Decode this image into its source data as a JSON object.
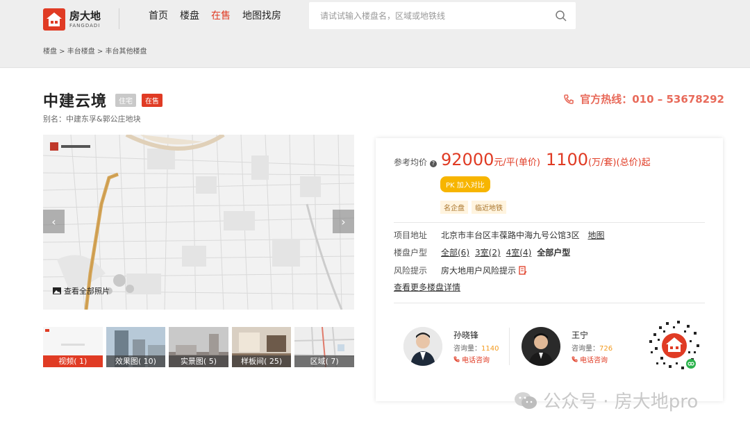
{
  "header": {
    "logo_cn": "房大地",
    "logo_en": "FANGDADI",
    "nav": [
      {
        "label": "首页",
        "active": false
      },
      {
        "label": "楼盘",
        "active": false
      },
      {
        "label": "在售",
        "active": true
      },
      {
        "label": "地图找房",
        "active": false
      }
    ],
    "search_placeholder": "请试试输入楼盘名，区域或地铁线"
  },
  "breadcrumb": [
    "楼盘",
    "丰台楼盘",
    "丰台其他楼盘"
  ],
  "breadcrumb_sep": " > ",
  "property": {
    "name": "中建云境",
    "type_tag": "住宅",
    "status_tag": "在售",
    "alias": "别名：中建东孚&郭公庄地块",
    "hotline": "官方热线：010 – 53678292"
  },
  "gallery": {
    "view_all": "查看全部照片",
    "thumbnails": [
      {
        "label": "视频( 1)"
      },
      {
        "label": "效果图( 10)"
      },
      {
        "label": "实景图( 5)"
      },
      {
        "label": "样板间( 25)"
      },
      {
        "label": "区域( 7)"
      }
    ]
  },
  "price": {
    "label": "参考均价",
    "unit_price": "92000",
    "unit_price_suffix": "元/平(单价)",
    "total_price": "1100",
    "total_price_suffix": "(万/套)(总价)起",
    "pk_label": "PK 加入对比",
    "features": [
      "名企盘",
      "临近地铁"
    ]
  },
  "details": {
    "address_label": "项目地址",
    "address": "北京市丰台区丰葆路中海九号公馆3区",
    "map_link": "地图",
    "layout_label": "楼盘户型",
    "layouts": [
      "全部(6)",
      "3室(2)",
      "4室(4)"
    ],
    "all_layouts": "全部户型",
    "risk_label": "风险提示",
    "risk_value": "房大地用户风险提示",
    "more_link": "查看更多楼盘详情"
  },
  "agents": [
    {
      "name": "孙晓锋",
      "count_label": "咨询量：",
      "count": "1140",
      "call": "电话咨询"
    },
    {
      "name": "王宁",
      "count_label": "咨询量：",
      "count": "726",
      "call": "电话咨询"
    }
  ],
  "watermark": "公众号 · 房大地pro",
  "colors": {
    "brand_red": "#e03b24",
    "accent_orange": "#f7b500",
    "hotline": "#e86a5a"
  }
}
